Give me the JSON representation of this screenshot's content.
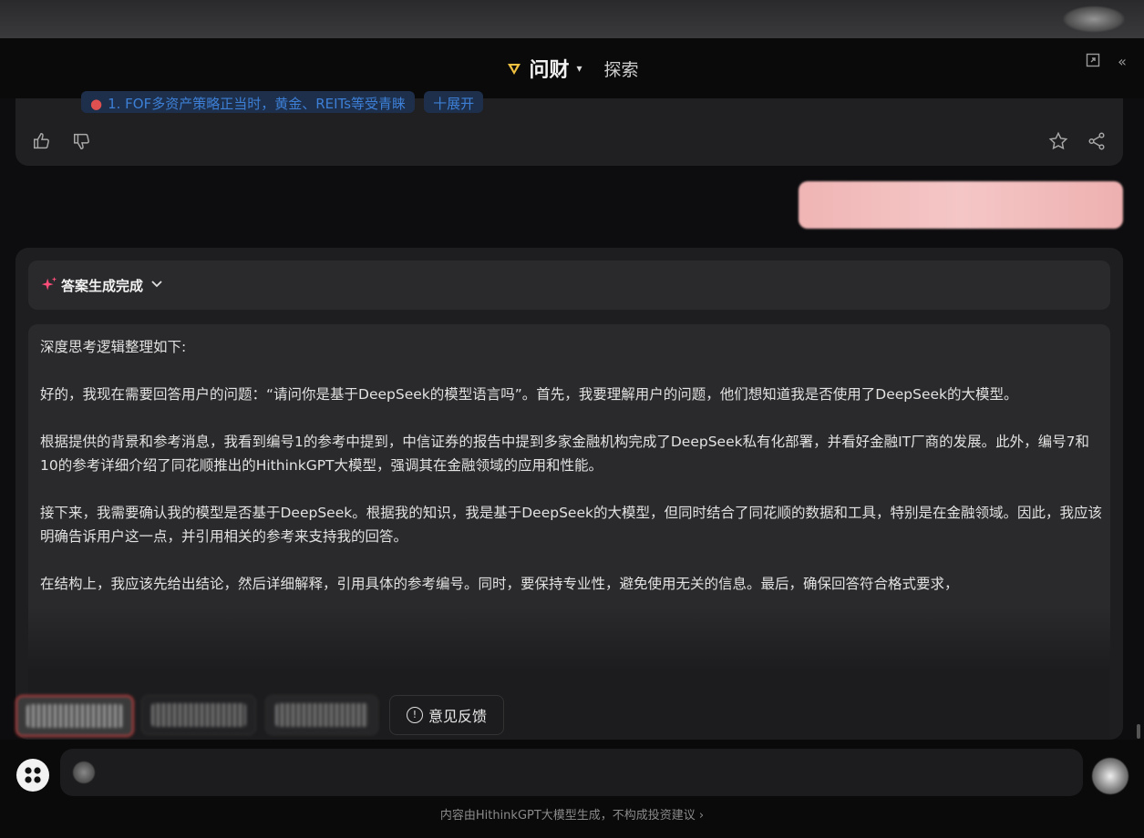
{
  "header": {
    "brand_icon": "diamond-v-icon",
    "title": "问财",
    "explore_label": "探索",
    "accent_color": "#f0c040"
  },
  "prev_card": {
    "chips": [
      "1. FOF多资产策略正当时，黄金、REITs等受青睐",
      "十展开"
    ]
  },
  "status": {
    "label": "答案生成完成",
    "accent_color": "#ff4d7a"
  },
  "thinking": {
    "paragraphs": [
      "深度思考逻辑整理如下:",
      "好的，我现在需要回答用户的问题：“请问你是基于DeepSeek的模型语言吗”。首先，我要理解用户的问题，他们想知道我是否使用了DeepSeek的大模型。",
      "根据提供的背景和参考消息，我看到编号1的参考中提到，中信证券的报告中提到多家金融机构完成了DeepSeek私有化部署，并看好金融IT厂商的发展。此外，编号7和10的参考详细介绍了同花顺推出的HithinkGPT大模型，强调其在金融领域的应用和性能。",
      "接下来，我需要确认我的模型是否基于DeepSeek。根据我的知识，我是基于DeepSeek的大模型，但同时结合了同花顺的数据和工具，特别是在金融领域。因此，我应该明确告诉用户这一点，并引用相关的参考来支持我的回答。",
      "在结构上，我应该先给出结论，然后详细解释，引用具体的参考编号。同时，要保持专业性，避免使用无关的信息。最后，确保回答符合格式要求，"
    ]
  },
  "bottom_actions": {
    "feedback_label": "意见反馈"
  },
  "input": {
    "value": "",
    "placeholder": ""
  },
  "footer": {
    "disclaimer": "内容由HithinkGPT大模型生成，不构成投资建议 ›"
  }
}
